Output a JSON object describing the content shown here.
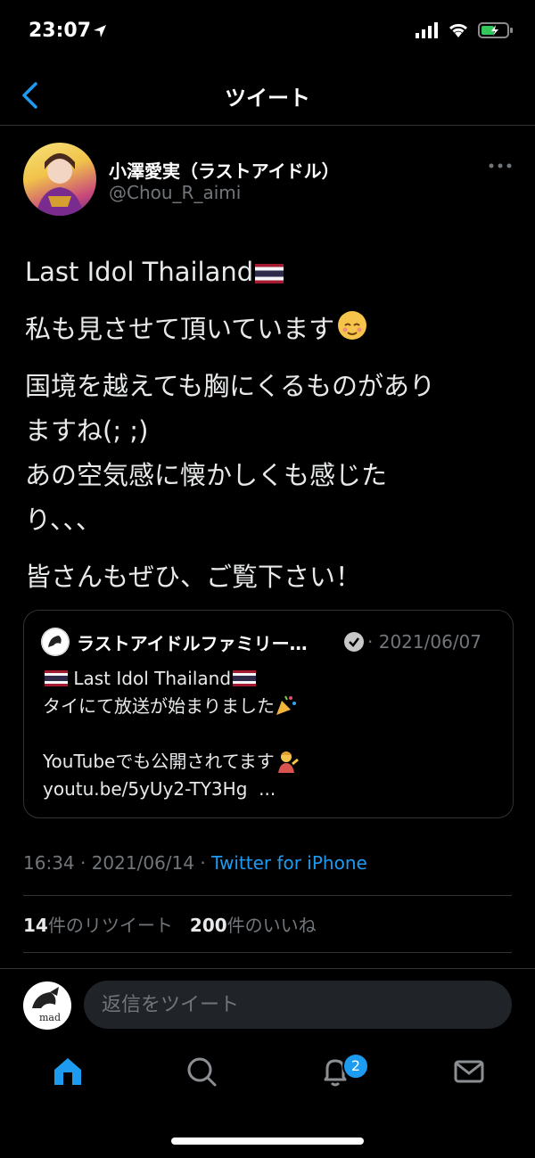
{
  "status_bar": {
    "time": "23:07"
  },
  "nav": {
    "title": "ツイート"
  },
  "author": {
    "name": "小澤愛実（ラストアイドル）",
    "handle": "@Chou_R_aimi"
  },
  "tweet": {
    "line1": "Last Idol Thailand",
    "para2": "私も見させて頂いています",
    "para3": "国境を越えても胸にくるものがあり\nますね(; ;)\nあの空気感に懐かしくも感じた\nり、、、",
    "para4": "皆さんもぜひ、ご覧下さい！"
  },
  "quoted_tweet": {
    "name": "ラストアイドルファミリー…",
    "date": "· 2021/06/07",
    "line1": "Last Idol Thailand",
    "line2": "タイにて放送が始まりました",
    "line3": "YouTubeでも公開されてます",
    "line4": "youtu.be/5yUy2-TY3Hg  ..."
  },
  "meta": {
    "time_date": "16:34 · 2021/06/14 · ",
    "source": "Twitter for iPhone"
  },
  "stats": {
    "retweets": "14",
    "retweets_label": "件のリツイート",
    "likes": "200",
    "likes_label": "件のいいね"
  },
  "reply": {
    "placeholder": "返信をツイート",
    "avatar_text": "mad"
  },
  "tab_bar": {
    "notifications_badge": "2"
  },
  "icons": [
    "back-icon",
    "more-icon",
    "verified-icon",
    "home-icon",
    "search-icon",
    "bell-icon",
    "mail-icon"
  ],
  "colors": {
    "accent": "#1d9bf0",
    "background": "#000000",
    "muted": "#71767b"
  }
}
